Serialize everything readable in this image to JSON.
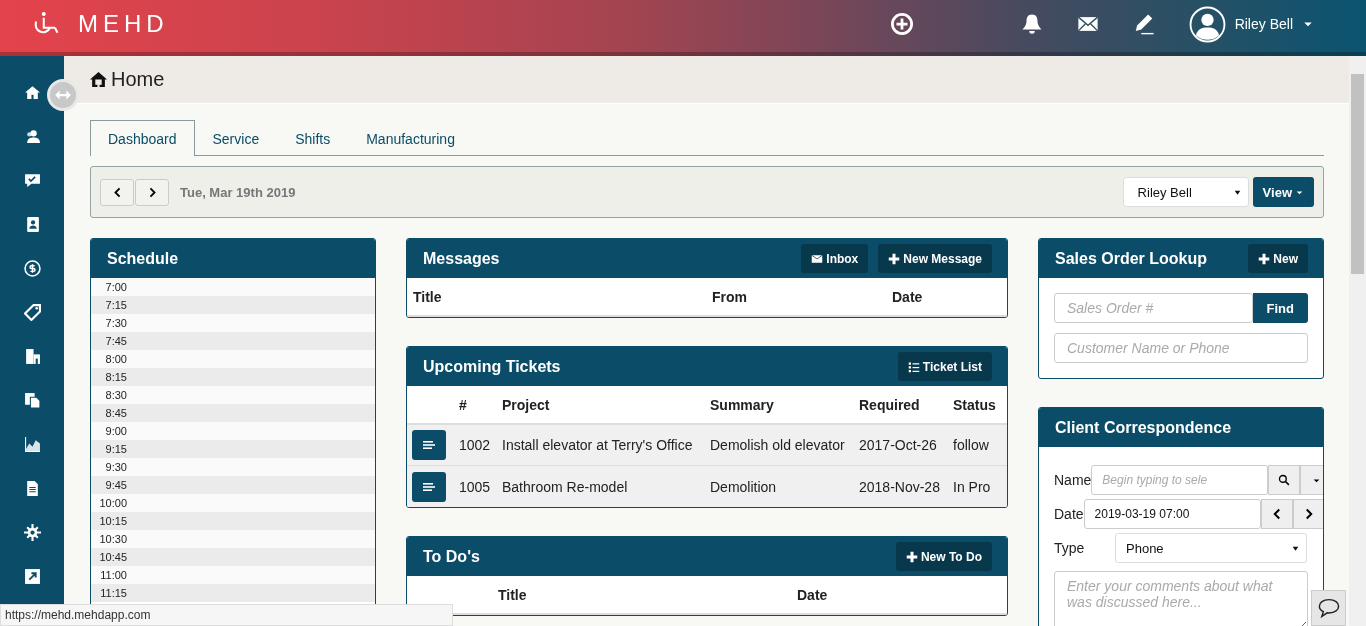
{
  "header": {
    "logo": "MEHD",
    "user": "Riley Bell"
  },
  "page": {
    "title": "Home"
  },
  "tabs": [
    {
      "label": "Dashboard",
      "selected": true
    },
    {
      "label": "Service",
      "selected": false
    },
    {
      "label": "Shifts",
      "selected": false
    },
    {
      "label": "Manufacturing",
      "selected": false
    }
  ],
  "toolbar": {
    "date": "Tue, Mar 19th 2019",
    "user_select": "Riley Bell",
    "view_button": "View"
  },
  "schedule": {
    "title": "Schedule",
    "times": [
      "7:00",
      "7:15",
      "7:30",
      "7:45",
      "8:00",
      "8:15",
      "8:30",
      "8:45",
      "9:00",
      "9:15",
      "9:30",
      "9:45",
      "10:00",
      "10:15",
      "10:30",
      "10:45",
      "11:00",
      "11:15"
    ]
  },
  "messages": {
    "title": "Messages",
    "inbox_button": "Inbox",
    "new_button": "New Message",
    "columns": [
      "Title",
      "From",
      "Date"
    ]
  },
  "tickets": {
    "title": "Upcoming Tickets",
    "list_button": "Ticket List",
    "columns": [
      "#",
      "Project",
      "Summary",
      "Required",
      "Status"
    ],
    "rows": [
      {
        "number": "1002",
        "project": "Install elevator at Terry's Office",
        "summary": "Demolish old elevator",
        "required": "2017-Oct-26",
        "status": "follow"
      },
      {
        "number": "1005",
        "project": "Bathroom Re-model",
        "summary": "Demolition",
        "required": "2018-Nov-28",
        "status": "In Pro"
      }
    ]
  },
  "todos": {
    "title": "To Do's",
    "new_button": "New To Do",
    "columns": [
      "Title",
      "Date"
    ]
  },
  "sales_order_lookup": {
    "title": "Sales Order Lookup",
    "new_button": "New",
    "order_field": {
      "placeholder": "Sales Order #"
    },
    "find_button": "Find",
    "customer_field": {
      "placeholder": "Customer Name or Phone"
    }
  },
  "client_correspondence": {
    "title": "Client Correspondence",
    "fields": [
      {
        "label": "Name",
        "kind": "search",
        "placeholder": "Begin typing to sele"
      },
      {
        "label": "Date",
        "kind": "date",
        "value": "2019-03-19 07:00"
      },
      {
        "label": "Type",
        "kind": "select",
        "value": "Phone"
      }
    ],
    "comments": {
      "placeholder": "Enter your comments about what was discussed here..."
    }
  },
  "status_bar": {
    "url": "https://mehd.mehdapp.com"
  }
}
